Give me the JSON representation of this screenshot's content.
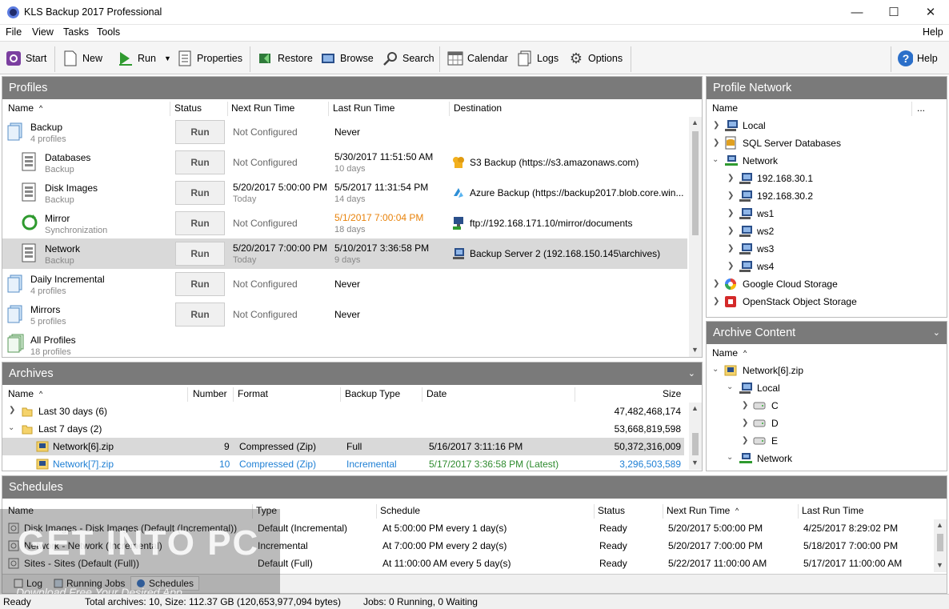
{
  "window": {
    "title": "KLS Backup 2017 Professional",
    "minimize": "—",
    "maximize": "☐",
    "close": "✕"
  },
  "menu": [
    "File",
    "View",
    "Tasks",
    "Tools",
    "Help"
  ],
  "toolbar": {
    "start": "Start",
    "new": "New",
    "run": "Run",
    "properties": "Properties",
    "restore": "Restore",
    "browse": "Browse",
    "search": "Search",
    "calendar": "Calendar",
    "logs": "Logs",
    "options": "Options",
    "help": "Help"
  },
  "profiles": {
    "title": "Profiles",
    "columns": [
      "Name",
      "Status",
      "Next Run Time",
      "Last Run Time",
      "Destination"
    ],
    "rows": [
      {
        "name": "Backup",
        "sub": "4 profiles",
        "status": "Run",
        "next": "Not Configured",
        "next_sub": "",
        "last": "Never",
        "last_sub": "",
        "dest": ""
      },
      {
        "name": "Databases",
        "sub": "Backup",
        "status": "Run",
        "next": "Not Configured",
        "next_sub": "",
        "last": "5/30/2017 11:51:50 AM",
        "last_sub": "10 days",
        "dest": "S3 Backup (https://s3.amazonaws.com)"
      },
      {
        "name": "Disk Images",
        "sub": "Backup",
        "status": "Run",
        "next": "5/20/2017 5:00:00 PM",
        "next_sub": "Today",
        "last": "5/5/2017 11:31:54 PM",
        "last_sub": "14 days",
        "dest": "Azure Backup (https://backup2017.blob.core.win..."
      },
      {
        "name": "Mirror",
        "sub": "Synchronization",
        "status": "Run",
        "next": "Not Configured",
        "next_sub": "",
        "last": "5/1/2017 7:00:04 PM",
        "last_sub": "18 days",
        "dest": "ftp://192.168.171.10/mirror/documents"
      },
      {
        "name": "Network",
        "sub": "Backup",
        "status": "Run",
        "next": "5/20/2017 7:00:00 PM",
        "next_sub": "Today",
        "last": "5/10/2017 3:36:58 PM",
        "last_sub": "9 days",
        "dest": "Backup Server 2 (192.168.150.145\\archives)"
      },
      {
        "name": "Daily Incremental",
        "sub": "4 profiles",
        "status": "Run",
        "next": "Not Configured",
        "next_sub": "",
        "last": "Never",
        "last_sub": "",
        "dest": ""
      },
      {
        "name": "Mirrors",
        "sub": "5 profiles",
        "status": "Run",
        "next": "Not Configured",
        "next_sub": "",
        "last": "Never",
        "last_sub": "",
        "dest": ""
      },
      {
        "name": "All Profiles",
        "sub": "18 profiles",
        "status": "",
        "next": "",
        "next_sub": "",
        "last": "",
        "last_sub": "",
        "dest": ""
      }
    ]
  },
  "archives": {
    "title": "Archives",
    "columns": [
      "Name",
      "Number",
      "Format",
      "Backup Type",
      "Date",
      "Size"
    ],
    "rows": [
      {
        "name": "Last 30 days (6)",
        "number": "",
        "format": "",
        "type": "",
        "date": "",
        "size": "47,482,468,174"
      },
      {
        "name": "Last 7 days (2)",
        "number": "",
        "format": "",
        "type": "",
        "date": "",
        "size": "53,668,819,598"
      },
      {
        "name": "Network[6].zip",
        "number": "9",
        "format": "Compressed (Zip)",
        "type": "Full",
        "date": "5/16/2017 3:11:16 PM",
        "size": "50,372,316,009"
      },
      {
        "name": "Network[7].zip",
        "number": "10",
        "format": "Compressed (Zip)",
        "type": "Incremental",
        "date": "5/17/2017 3:36:58 PM (Latest)",
        "size": "3,296,503,589"
      }
    ]
  },
  "profile_network": {
    "title": "Profile Network",
    "column": "Name",
    "more": "...",
    "items": [
      "Local",
      "SQL Server Databases",
      "Network",
      "192.168.30.1",
      "192.168.30.2",
      "ws1",
      "ws2",
      "ws3",
      "ws4",
      "Google Cloud Storage",
      "OpenStack Object Storage"
    ]
  },
  "archive_content": {
    "title": "Archive Content",
    "column": "Name",
    "items": [
      "Network[6].zip",
      "Local",
      "C",
      "D",
      "E",
      "Network"
    ]
  },
  "schedules": {
    "title": "Schedules",
    "columns": [
      "Name",
      "Type",
      "Schedule",
      "Status",
      "Next Run Time",
      "Last Run Time"
    ],
    "rows": [
      {
        "name": "Disk Images - Disk Images (Default (Incremental))",
        "type": "Default (Incremental)",
        "schedule": "At 5:00:00 PM every 1 day(s)",
        "status": "Ready",
        "next": "5/20/2017 5:00:00 PM",
        "last": "4/25/2017 8:29:02 PM"
      },
      {
        "name": "Network - Network (Incremental)",
        "type": "Incremental",
        "schedule": "At 7:00:00 PM every 2 day(s)",
        "status": "Ready",
        "next": "5/20/2017 7:00:00 PM",
        "last": "5/18/2017 7:00:00 PM"
      },
      {
        "name": "Sites - Sites (Default (Full))",
        "type": "Default (Full)",
        "schedule": "At 11:00:00 AM every 5 day(s)",
        "status": "Ready",
        "next": "5/22/2017 11:00:00 AM",
        "last": "5/17/2017 11:00:00 AM"
      }
    ],
    "tabs": [
      "Log",
      "Running Jobs",
      "Schedules"
    ]
  },
  "statusbar": {
    "ready": "Ready",
    "archives": "Total archives: 10, Size: 112.37 GB (120,653,977,094 bytes)",
    "jobs": "Jobs: 0 Running, 0 Waiting"
  },
  "watermark": {
    "line1": "GET INTO PC",
    "line2": "Download Free Your Desired App"
  },
  "colors": {
    "orange_date": "#e8820a",
    "blue_link": "#1e7fd4",
    "green_latest": "#2e8b2e",
    "panel_header": "#7a7a7a",
    "selected_row": "#d9d9d9"
  }
}
